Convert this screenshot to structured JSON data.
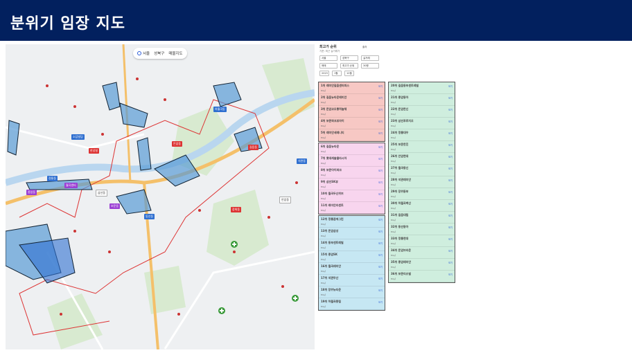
{
  "header": {
    "title": "분위기 임장 지도",
    "bg": "#02205e"
  },
  "map": {
    "toolbar": {
      "location": "서울",
      "district": "성북구",
      "mode": "매물지도"
    },
    "labels": [
      {
        "text": "소담빌딩",
        "color": "blue"
      },
      {
        "text": "한성빌",
        "color": "red"
      },
      {
        "text": "월곡센터",
        "color": "purple"
      },
      {
        "text": "삼선동",
        "color": "white"
      },
      {
        "text": "정릉동",
        "color": "blue"
      },
      {
        "text": "돈암동",
        "color": "red"
      },
      {
        "text": "하월곡동",
        "color": "blue"
      },
      {
        "text": "길음동",
        "color": "red"
      },
      {
        "text": "보문동",
        "color": "purple"
      },
      {
        "text": "동선동",
        "color": "blue"
      },
      {
        "text": "안암동",
        "color": "white"
      },
      {
        "text": "석관동",
        "color": "blue"
      },
      {
        "text": "장위동",
        "color": "red"
      },
      {
        "text": "종암동",
        "color": "purple"
      }
    ]
  },
  "panel": {
    "title": "최고가 순위",
    "subtitle": "기준: 최근 실거래가",
    "link": "출처",
    "filters": [
      "서울",
      "성북구",
      "실거래",
      "매매",
      "최고가 순위",
      "30평",
      "2023",
      "1월",
      "12월"
    ],
    "groups": [
      {
        "color": "red",
        "items": [
          {
            "rank": "1위",
            "name": "래미안길음센터피스",
            "desc": "84㎡",
            "btn": "보기"
          },
          {
            "rank": "2위",
            "name": "길음뉴타운래미안",
            "desc": "84㎡",
            "btn": "보기"
          },
          {
            "rank": "3위",
            "name": "돈암코오롱하늘채",
            "desc": "84㎡",
            "btn": "보기"
          },
          {
            "rank": "4위",
            "name": "보문파크뷰자이",
            "desc": "84㎡",
            "btn": "보기"
          },
          {
            "rank": "5위",
            "name": "래미안세레니티",
            "desc": "84㎡",
            "btn": "보기"
          }
        ]
      },
      {
        "color": "pink",
        "items": [
          {
            "rank": "6위",
            "name": "길음뉴타운",
            "desc": "84㎡",
            "btn": "보기"
          },
          {
            "rank": "7위",
            "name": "롯데캐슬클라시아",
            "desc": "84㎡",
            "btn": "보기"
          },
          {
            "rank": "8위",
            "name": "보문아이파크",
            "desc": "84㎡",
            "btn": "보기"
          },
          {
            "rank": "9위",
            "name": "삼선SK뷰",
            "desc": "84㎡",
            "btn": "보기"
          },
          {
            "rank": "10위",
            "name": "월곡두산위브",
            "desc": "84㎡",
            "btn": "보기"
          },
          {
            "rank": "11위",
            "name": "래미안라센트",
            "desc": "84㎡",
            "btn": "보기"
          }
        ]
      },
      {
        "color": "blue",
        "items": [
          {
            "rank": "12위",
            "name": "정릉꿈에그린",
            "desc": "84㎡",
            "btn": "보기"
          },
          {
            "rank": "13위",
            "name": "돈암삼성",
            "desc": "84㎡",
            "btn": "보기"
          },
          {
            "rank": "14위",
            "name": "동부센트레빌",
            "desc": "84㎡",
            "btn": "보기"
          },
          {
            "rank": "15위",
            "name": "종암SK",
            "desc": "84㎡",
            "btn": "보기"
          },
          {
            "rank": "16위",
            "name": "월곡래미안",
            "desc": "84㎡",
            "btn": "보기"
          },
          {
            "rank": "17위",
            "name": "석관두산",
            "desc": "84㎡",
            "btn": "보기"
          },
          {
            "rank": "18위",
            "name": "장위뉴타운",
            "desc": "84㎡",
            "btn": "보기"
          },
          {
            "rank": "19위",
            "name": "하월곡풍림",
            "desc": "84㎡",
            "btn": "보기"
          }
        ]
      },
      {
        "color": "green",
        "items": [
          {
            "rank": "20위",
            "name": "길음동부센트레빌",
            "desc": "84㎡",
            "btn": "보기"
          },
          {
            "rank": "21위",
            "name": "종암동아",
            "desc": "84㎡",
            "btn": "보기"
          },
          {
            "rank": "22위",
            "name": "돈암한신",
            "desc": "84㎡",
            "btn": "보기"
          },
          {
            "rank": "23위",
            "name": "삼선푸르지오",
            "desc": "84㎡",
            "btn": "보기"
          },
          {
            "rank": "24위",
            "name": "정릉대우",
            "desc": "84㎡",
            "btn": "보기"
          },
          {
            "rank": "25위",
            "name": "보문한진",
            "desc": "84㎡",
            "btn": "보기"
          },
          {
            "rank": "26위",
            "name": "안암현대",
            "desc": "84㎡",
            "btn": "보기"
          },
          {
            "rank": "27위",
            "name": "월곡동신",
            "desc": "84㎡",
            "btn": "보기"
          },
          {
            "rank": "28위",
            "name": "석관래미안",
            "desc": "84㎡",
            "btn": "보기"
          },
          {
            "rank": "29위",
            "name": "장위동부",
            "desc": "84㎡",
            "btn": "보기"
          },
          {
            "rank": "30위",
            "name": "하월곡벽산",
            "desc": "84㎡",
            "btn": "보기"
          },
          {
            "rank": "31위",
            "name": "길음대림",
            "desc": "84㎡",
            "btn": "보기"
          },
          {
            "rank": "32위",
            "name": "동선동아",
            "desc": "84㎡",
            "btn": "보기"
          },
          {
            "rank": "33위",
            "name": "정릉현대",
            "desc": "84㎡",
            "btn": "보기"
          },
          {
            "rank": "34위",
            "name": "돈암브라운",
            "desc": "84㎡",
            "btn": "보기"
          },
          {
            "rank": "35위",
            "name": "종암래미안",
            "desc": "84㎡",
            "btn": "보기"
          },
          {
            "rank": "36위",
            "name": "보문리슈빌",
            "desc": "84㎡",
            "btn": "보기"
          }
        ]
      }
    ]
  }
}
